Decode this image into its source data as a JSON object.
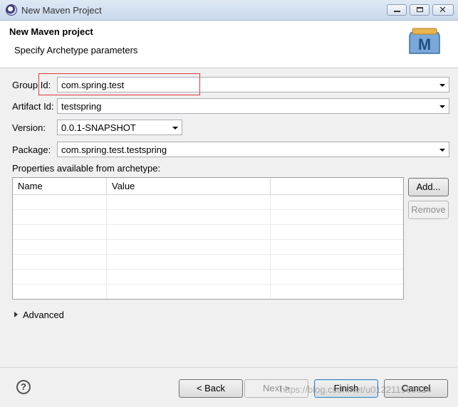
{
  "window": {
    "title": "New Maven Project"
  },
  "header": {
    "title": "New Maven project",
    "subtitle": "Specify Archetype parameters",
    "icon": "maven-m-icon"
  },
  "form": {
    "group_id_label": "Group Id:",
    "group_id_value": "com.spring.test",
    "artifact_id_label": "Artifact Id:",
    "artifact_id_value": "testspring",
    "version_label": "Version:",
    "version_value": "0.0.1-SNAPSHOT",
    "package_label": "Package:",
    "package_value": "com.spring.test.testspring"
  },
  "properties": {
    "label": "Properties available from archetype:",
    "columns": [
      "Name",
      "Value"
    ],
    "rows": [],
    "add_label": "Add...",
    "remove_label": "Remove"
  },
  "advanced": {
    "label": "Advanced"
  },
  "footer": {
    "back_label": "< Back",
    "next_label": "Next >",
    "finish_label": "Finish",
    "cancel_label": "Cancel",
    "help_symbol": "?"
  },
  "watermark": "https://blog.csdn.net/u012211560624",
  "colors": {
    "highlight": "#e03a3a",
    "default_button_border": "#3c7fb1"
  }
}
